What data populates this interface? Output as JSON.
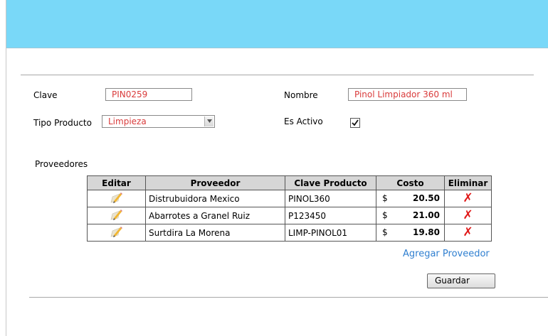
{
  "form": {
    "clave_label": "Clave",
    "clave_value": "PIN0259",
    "nombre_label": "Nombre",
    "nombre_value": "Pinol Limpiador 360 ml",
    "tipo_label": "Tipo Producto",
    "tipo_value": "Limpieza",
    "activo_label": "Es Activo",
    "activo_checked": true,
    "proveedores_label": "Proveedores"
  },
  "table": {
    "headers": [
      "Editar",
      "Proveedor",
      "Clave Producto",
      "Costo",
      "Eliminar"
    ],
    "rows": [
      {
        "proveedor": "Distrubuidora Mexico",
        "clave": "PINOL360",
        "currency": "$",
        "costo": "20.50",
        "delete": "✗"
      },
      {
        "proveedor": "Abarrotes a Granel Ruiz",
        "clave": "P123450",
        "currency": "$",
        "costo": "21.00",
        "delete": "✗"
      },
      {
        "proveedor": "Surtdira La Morena",
        "clave": "LIMP-PINOL01",
        "currency": "$",
        "costo": "19.80",
        "delete": "✗"
      }
    ]
  },
  "actions": {
    "add_provider_label": "Agregar Proveedor",
    "save_label": "Guardar"
  },
  "colors": {
    "header_bar": "#79d8f8",
    "field_text": "#d93b3b",
    "link": "#2f7fd0",
    "delete": "#e01818"
  }
}
